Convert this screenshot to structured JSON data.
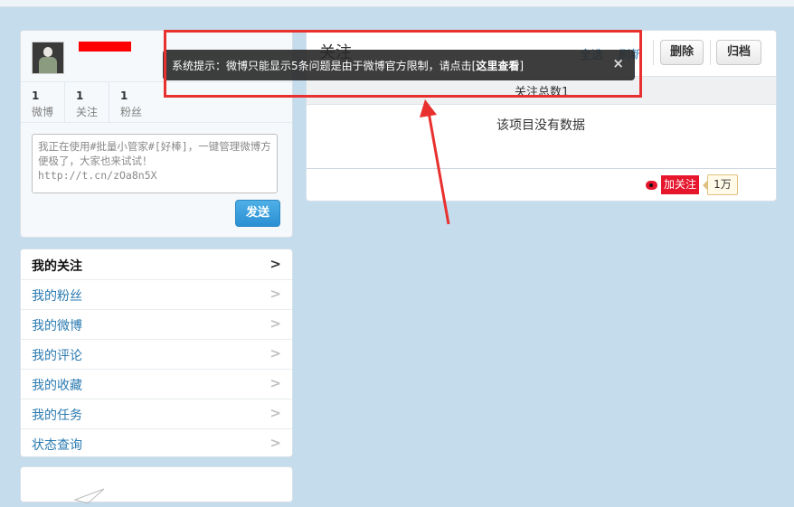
{
  "profile": {
    "stats": [
      {
        "value": "1",
        "label": "微博"
      },
      {
        "value": "1",
        "label": "关注"
      },
      {
        "value": "1",
        "label": "粉丝"
      }
    ],
    "compose_placeholder": "我正在使用#批量小管家#[好棒]，一键管理微博方便极了，大家也来试试！ http://t.cn/zOa8n5X",
    "send_label": "发送"
  },
  "menu": {
    "items": [
      {
        "label": "我的关注",
        "active": true
      },
      {
        "label": "我的粉丝"
      },
      {
        "label": "我的微博"
      },
      {
        "label": "我的评论"
      },
      {
        "label": "我的收藏"
      },
      {
        "label": "我的任务"
      },
      {
        "label": "状态查询"
      }
    ],
    "chevron": ">"
  },
  "main": {
    "title": "关注",
    "select_all": "全选",
    "refresh": "刷新",
    "delete_label": "删除",
    "archive_label": "归档",
    "total": "关注总数1",
    "empty": "该项目没有数据",
    "follow_label": "加关注",
    "follow_count": "1万"
  },
  "toast": {
    "message": "系统提示：微博只能显示5条问题是由于微博官方限制，请点击[",
    "link": "这里查看",
    "suffix": "]",
    "close": "×"
  },
  "colors": {
    "accent": "#2a7ab0",
    "annotation": "#e8302e",
    "brand_red": "#e6162d"
  }
}
